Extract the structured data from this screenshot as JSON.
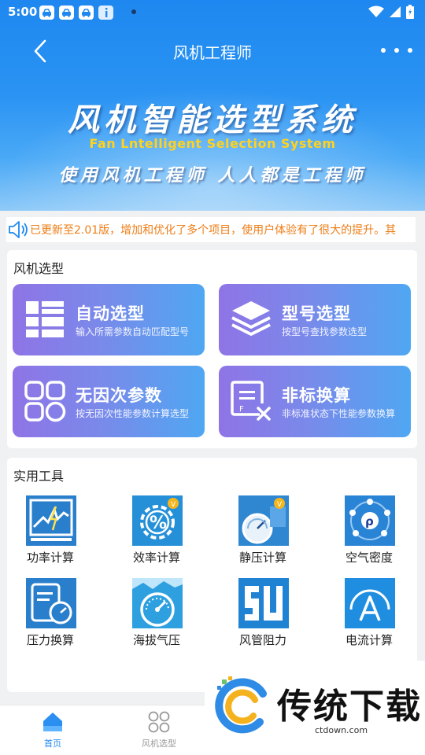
{
  "status_bar": {
    "time": "5:00",
    "app_icons": [
      "car-app-icon",
      "car-app-icon",
      "car-app-icon",
      "info-app-icon"
    ]
  },
  "header": {
    "title": "风机工程师"
  },
  "banner": {
    "title": "风机智能选型系统",
    "subtitle_en": "Fan Lntelligent Selection System",
    "slogan": "使用风机工程师   人人都是工程师"
  },
  "notice": {
    "text": "已更新至2.01版，增加和优化了多个项目，使用户体验有了很大的提升。其"
  },
  "fan_selection": {
    "title": "风机选型",
    "tiles": [
      {
        "title": "自动选型",
        "subtitle": "输入所需参数自动匹配型号",
        "icon": "list-icon"
      },
      {
        "title": "型号选型",
        "subtitle": "按型号查找参数选型",
        "icon": "layers-icon"
      },
      {
        "title": "无因次参数",
        "subtitle": "按无因次性能参数计算选型",
        "icon": "grid-circles-icon"
      },
      {
        "title": "非标换算",
        "subtitle": "非标准状态下性能参数换算",
        "icon": "doc-formula-icon"
      }
    ]
  },
  "tools": {
    "title": "实用工具",
    "items": [
      {
        "label": "功率计算",
        "icon": "power-chart-icon"
      },
      {
        "label": "效率计算",
        "icon": "percent-gear-icon"
      },
      {
        "label": "静压计算",
        "icon": "pressure-gauge-icon"
      },
      {
        "label": "空气密度",
        "icon": "air-density-icon"
      },
      {
        "label": "压力换算",
        "icon": "pressure-doc-icon"
      },
      {
        "label": "海拔气压",
        "icon": "altitude-gauge-icon"
      },
      {
        "label": "风管阻力",
        "icon": "duct-icon"
      },
      {
        "label": "电流计算",
        "icon": "current-icon"
      }
    ]
  },
  "bottom_nav": {
    "items": [
      {
        "label": "首页",
        "icon": "home-icon",
        "active": true
      },
      {
        "label": "风机选型",
        "icon": "four-circles-icon",
        "active": false
      }
    ]
  },
  "watermark": {
    "text": "传统下载",
    "url": "ctdown.com"
  },
  "colors": {
    "primary": "#1e88f0",
    "notice": "#ee7d16",
    "tile_start": "#8f74e6",
    "tile_end": "#4fa7f2"
  }
}
